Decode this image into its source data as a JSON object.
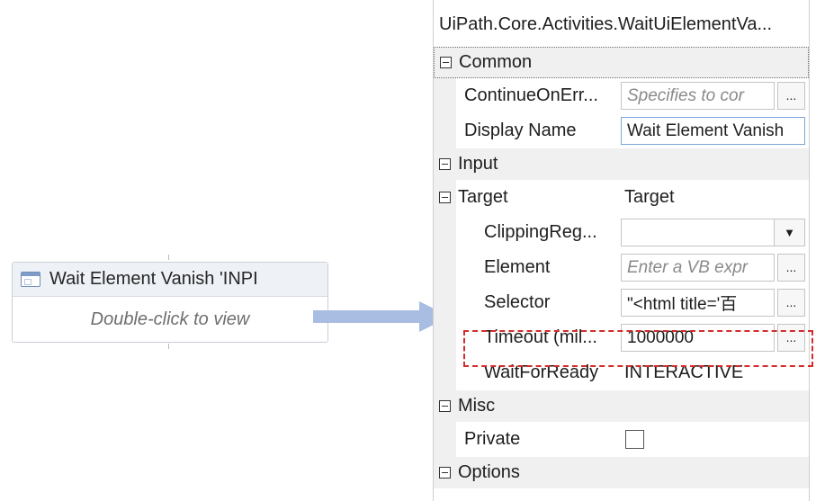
{
  "activity": {
    "title": "Wait Element Vanish 'INPI",
    "hint": "Double-click to view"
  },
  "panel": {
    "title": "UiPath.Core.Activities.WaitUiElementVa...",
    "categories": {
      "common": "Common",
      "input": "Input",
      "misc": "Misc",
      "options": "Options"
    },
    "props": {
      "continue_on_error": {
        "label": "ContinueOnErr...",
        "placeholder": "Specifies to cor"
      },
      "display_name": {
        "label": "Display Name",
        "value": "Wait Element Vanish"
      },
      "target": {
        "label": "Target",
        "value": "Target"
      },
      "clipping_region": {
        "label": "ClippingReg...",
        "value": ""
      },
      "element": {
        "label": "Element",
        "placeholder": "Enter a VB expr"
      },
      "selector": {
        "label": "Selector",
        "value": "\"<html title='百"
      },
      "timeout": {
        "label": "Timeout (mil...",
        "value": "1000000"
      },
      "wait_for_ready": {
        "label": "WaitForReady",
        "value": "INTERACTIVE"
      },
      "private": {
        "label": "Private",
        "checked": false
      }
    },
    "ellipsis": "...",
    "dropdown_glyph": "▼"
  },
  "colors": {
    "highlight": "#d62b2b",
    "arrow": "#a9bde2",
    "category_bg": "#f0f0f0",
    "activity_header_bg": "#eef1f6"
  }
}
